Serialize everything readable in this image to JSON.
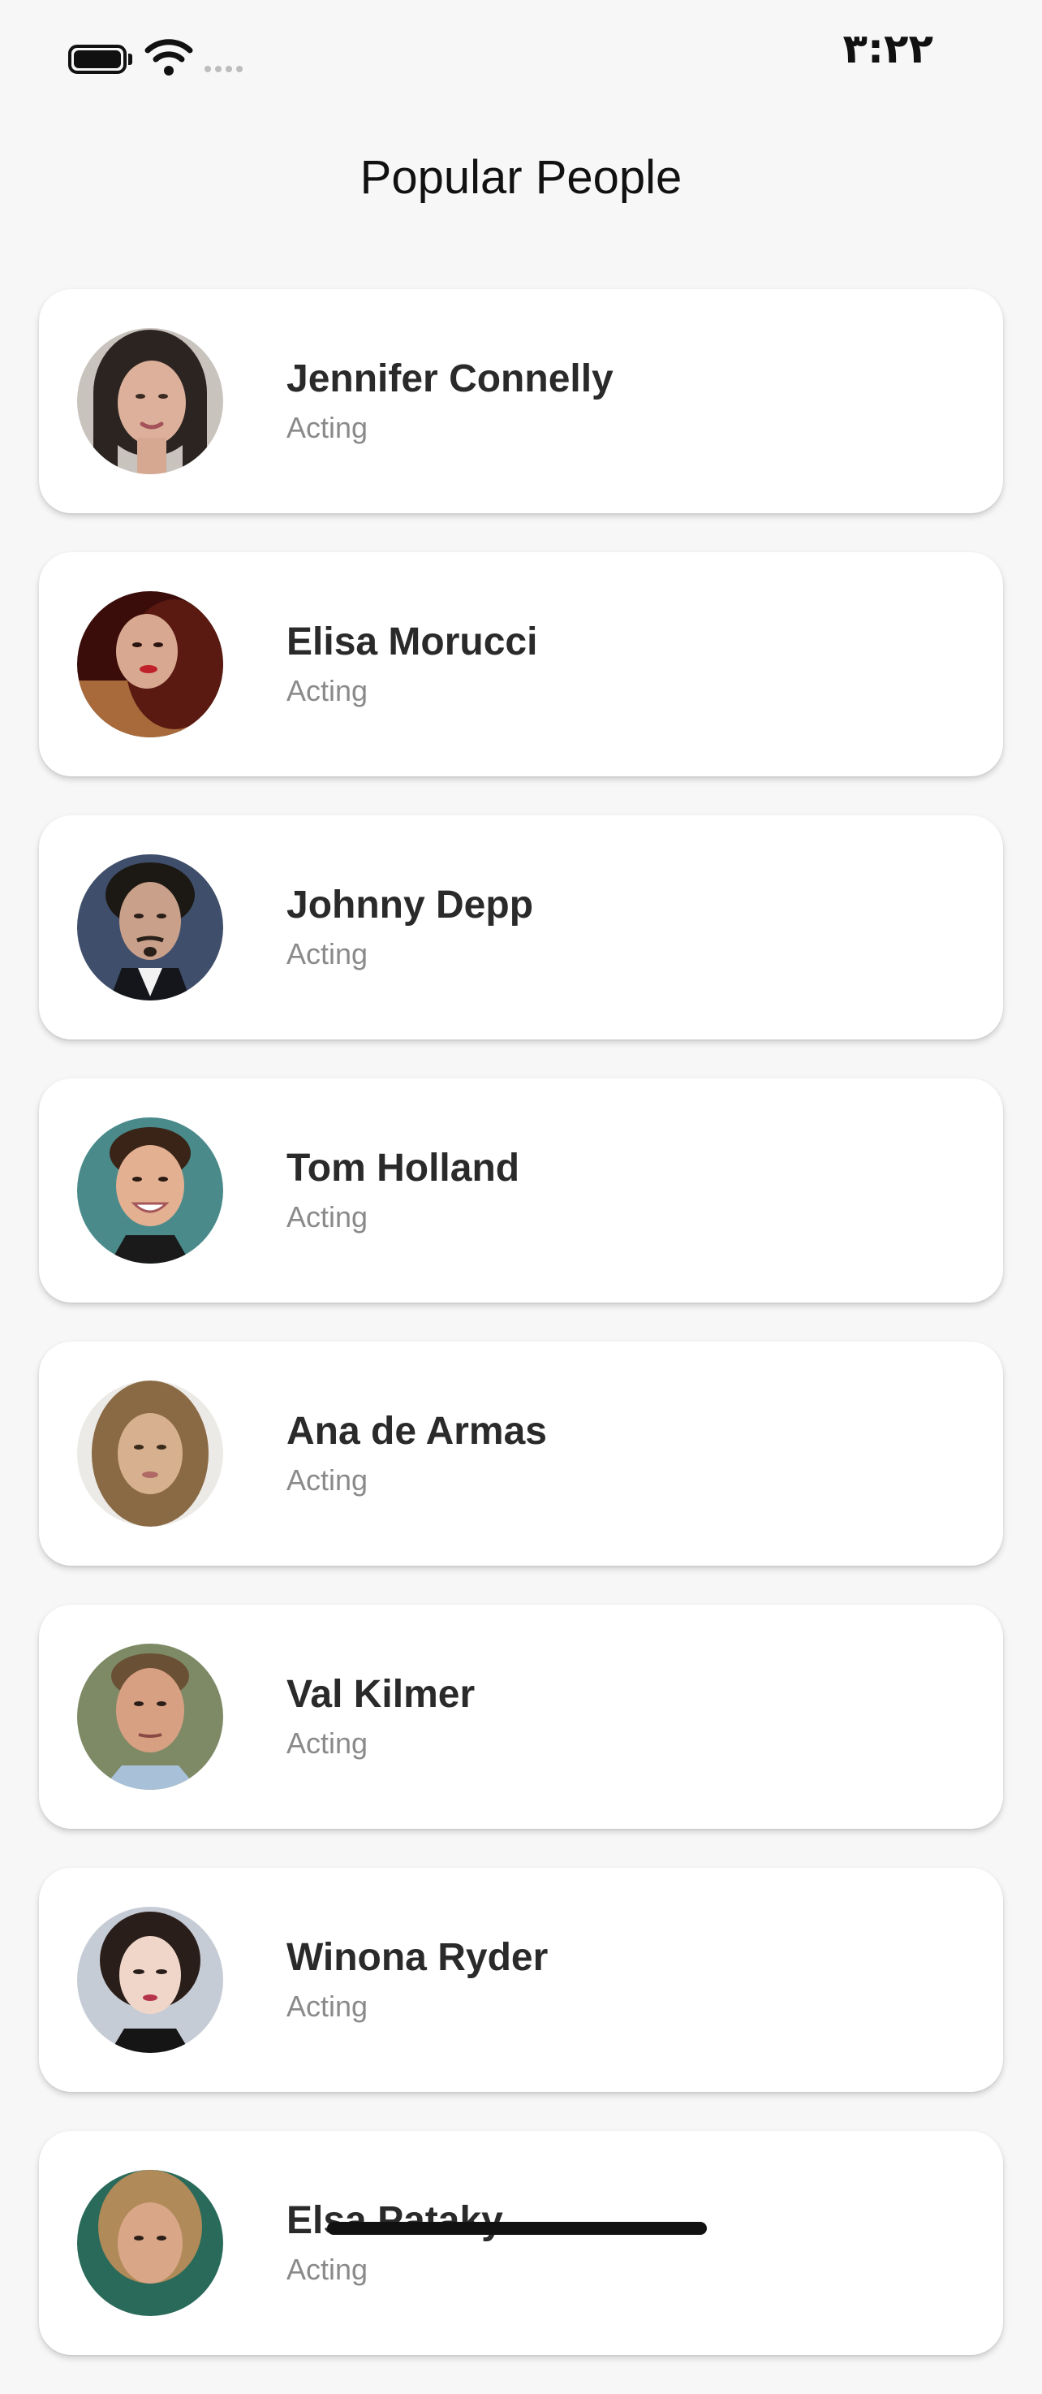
{
  "status_bar": {
    "time": "٣:٢٢",
    "icons": [
      "battery-icon",
      "wifi-icon",
      "signal-dots-icon"
    ]
  },
  "header": {
    "title": "Popular People"
  },
  "people": [
    {
      "name": "Jennifer Connelly",
      "department": "Acting"
    },
    {
      "name": "Elisa Morucci",
      "department": "Acting"
    },
    {
      "name": "Johnny Depp",
      "department": "Acting"
    },
    {
      "name": "Tom Holland",
      "department": "Acting"
    },
    {
      "name": "Ana de Armas",
      "department": "Acting"
    },
    {
      "name": "Val Kilmer",
      "department": "Acting"
    },
    {
      "name": "Winona Ryder",
      "department": "Acting"
    },
    {
      "name": "Elsa Pataky",
      "department": "Acting"
    }
  ],
  "colors": {
    "background": "#f7f7f7",
    "card": "#ffffff",
    "name_text": "#2a2a2a",
    "department_text": "#8a8a8a"
  }
}
